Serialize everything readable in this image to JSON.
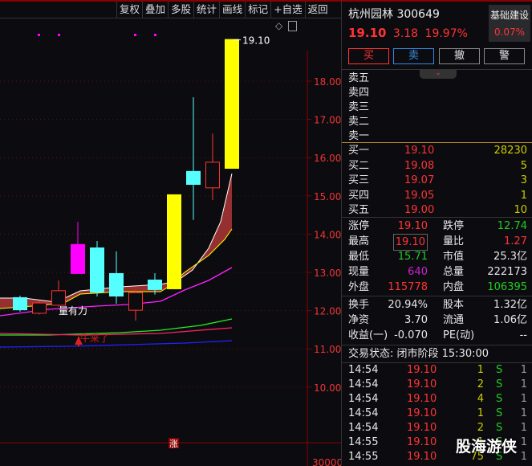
{
  "toolbar": [
    "复权",
    "叠加",
    "多股",
    "统计",
    "画线",
    "标记",
    "+自选",
    "返回"
  ],
  "stock": {
    "name": "杭州园林",
    "code": "300649",
    "price": "19.10",
    "change": "3.18",
    "pct": "19.97%",
    "sector": "基础建设",
    "sector_pct": "0.07%"
  },
  "actions": {
    "buy": "买",
    "sell": "卖",
    "cancel": "撤",
    "alert": "警"
  },
  "asks": [
    {
      "label": "卖五"
    },
    {
      "label": "卖四"
    },
    {
      "label": "卖三"
    },
    {
      "label": "卖二"
    },
    {
      "label": "卖一"
    }
  ],
  "bids": [
    {
      "label": "买一",
      "price": "19.10",
      "vol": "28230"
    },
    {
      "label": "买二",
      "price": "19.08",
      "vol": "5"
    },
    {
      "label": "买三",
      "price": "19.07",
      "vol": "3"
    },
    {
      "label": "买四",
      "price": "19.05",
      "vol": "1"
    },
    {
      "label": "买五",
      "price": "19.00",
      "vol": "10"
    }
  ],
  "stats": [
    {
      "l1": "涨停",
      "v1": "19.10",
      "c1": "r",
      "l2": "跌停",
      "v2": "12.74",
      "c2": "g"
    },
    {
      "l1": "最高",
      "v1": "19.10",
      "c1": "r",
      "l2": "量比",
      "v2": "1.27",
      "c2": "r"
    },
    {
      "l1": "最低",
      "v1": "15.71",
      "c1": "g",
      "l2": "市值",
      "v2": "25.3亿",
      "c2": "w"
    },
    {
      "l1": "现量",
      "v1": "640",
      "c1": "m",
      "l2": "总量",
      "v2": "222173",
      "c2": "w"
    },
    {
      "l1": "外盘",
      "v1": "115778",
      "c1": "r",
      "l2": "内盘",
      "v2": "106395",
      "c2": "g"
    }
  ],
  "stats2": [
    {
      "l1": "换手",
      "v1": "20.94%",
      "l2": "股本",
      "v2": "1.32亿"
    },
    {
      "l1": "净资",
      "v1": "3.70",
      "l2": "流通",
      "v2": "1.06亿"
    },
    {
      "l1": "收益(一)",
      "v1": "-0.070",
      "l2": "PE(动)",
      "v2": "--"
    }
  ],
  "status": "交易状态: 闭市阶段 15:30:00",
  "ticks": [
    {
      "t": "14:54",
      "p": "19.10",
      "v": "1",
      "s": "S",
      "n": "1"
    },
    {
      "t": "14:54",
      "p": "19.10",
      "v": "2",
      "s": "S",
      "n": "1"
    },
    {
      "t": "14:54",
      "p": "19.10",
      "v": "4",
      "s": "S",
      "n": "1"
    },
    {
      "t": "14:54",
      "p": "19.10",
      "v": "1",
      "s": "S",
      "n": "1"
    },
    {
      "t": "14:54",
      "p": "19.10",
      "v": "2",
      "s": "S",
      "n": "1"
    },
    {
      "t": "14:55",
      "p": "19.10",
      "v": "1",
      "s": "S",
      "n": "1"
    },
    {
      "t": "14:55",
      "p": "19.10",
      "v": "75",
      "s": "S",
      "n": "1"
    }
  ],
  "watermark": "股海游侠",
  "chart": {
    "last_label": "19.10",
    "annot1": "量有力",
    "annot2": "牛来了",
    "marker": "涨",
    "y_ticks": [
      "18.00",
      "17.00",
      "16.00",
      "15.00",
      "14.00",
      "13.00",
      "12.00",
      "11.00",
      "10.00"
    ],
    "vol_tick": "30000",
    "candles": [
      {
        "o": 12.35,
        "c": 12.01,
        "h": 12.39,
        "l": 11.97,
        "k": "down"
      },
      {
        "o": 11.93,
        "c": 12.2,
        "h": 12.25,
        "l": 11.9,
        "k": "up"
      },
      {
        "o": 12.14,
        "c": 12.52,
        "h": 12.79,
        "l": 12.1,
        "k": "up"
      },
      {
        "o": 12.96,
        "c": 13.74,
        "h": 14.32,
        "l": 12.96,
        "k": "magenta"
      },
      {
        "o": 13.65,
        "c": 12.47,
        "h": 13.82,
        "l": 12.37,
        "k": "down"
      },
      {
        "o": 12.98,
        "c": 12.37,
        "h": 13.55,
        "l": 12.18,
        "k": "down"
      },
      {
        "o": 12.01,
        "c": 12.47,
        "h": 12.54,
        "l": 11.74,
        "k": "up"
      },
      {
        "o": 12.81,
        "c": 12.54,
        "h": 12.98,
        "l": 12.42,
        "k": "down"
      },
      {
        "o": 12.56,
        "c": 15.04,
        "h": 15.04,
        "l": 12.56,
        "k": "limit"
      },
      {
        "o": 15.65,
        "c": 15.29,
        "h": 17.58,
        "l": 14.37,
        "k": "down"
      },
      {
        "o": 15.21,
        "c": 15.88,
        "h": 16.63,
        "l": 14.89,
        "k": "up"
      },
      {
        "o": 15.71,
        "c": 19.1,
        "h": 19.1,
        "l": 15.71,
        "k": "limit"
      }
    ]
  }
}
